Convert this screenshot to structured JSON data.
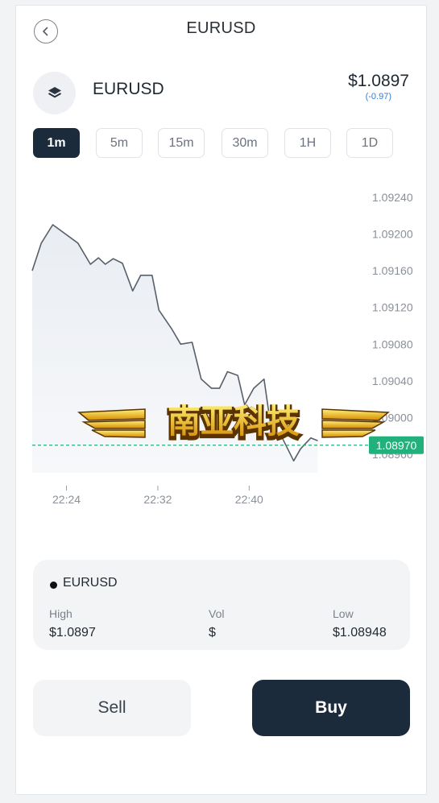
{
  "header": {
    "title": "EURUSD",
    "back_icon": "chevron-left-icon"
  },
  "symbol": {
    "icon": "layers-icon",
    "name": "EURUSD",
    "price": "$1.0897",
    "change": "(-0.97)"
  },
  "timeframes": [
    {
      "label": "1m",
      "active": true
    },
    {
      "label": "5m",
      "active": false
    },
    {
      "label": "15m",
      "active": false
    },
    {
      "label": "30m",
      "active": false
    },
    {
      "label": "1H",
      "active": false
    },
    {
      "label": "1D",
      "active": false
    }
  ],
  "chart_data": {
    "type": "area",
    "y_ticks": [
      "1.09240",
      "1.09200",
      "1.09160",
      "1.09120",
      "1.09080",
      "1.09040",
      "1.09000",
      "1.08960"
    ],
    "ylim": [
      1.0894,
      1.0926
    ],
    "x_ticks": [
      "22:24",
      "22:32",
      "22:40"
    ],
    "x_tick_minutes": [
      24,
      32,
      40
    ],
    "xlim": [
      21.0,
      49.5
    ],
    "series": [
      {
        "x": [
          21.0,
          21.8,
          22.8,
          25.0,
          26.1,
          26.8,
          27.4,
          28.1,
          28.9,
          29.8,
          30.5,
          31.5,
          32.1,
          33.2,
          34.0,
          35.0,
          35.8,
          36.7,
          37.4,
          38.1,
          39.0,
          39.6,
          40.4,
          41.3,
          41.9,
          42.9,
          43.9,
          44.5,
          45.4,
          46.0
        ],
        "values": [
          1.0916,
          1.0919,
          1.0921,
          1.0919,
          1.09167,
          1.09174,
          1.09167,
          1.09173,
          1.09168,
          1.09138,
          1.09155,
          1.09155,
          1.09117,
          1.09097,
          1.0908,
          1.09082,
          1.09042,
          1.09032,
          1.09032,
          1.0905,
          1.09046,
          1.09014,
          1.09032,
          1.09042,
          1.0899,
          1.08978,
          1.08953,
          1.08966,
          1.08978,
          1.08975
        ]
      }
    ],
    "current_price_label": "1.08970",
    "current_price": 1.0897,
    "colors": {
      "line": "#56606b",
      "fill": "#eef1f5",
      "price_line": "#22b07d",
      "price_tag": "#22b07d"
    },
    "grid": false
  },
  "watermark": {
    "text": "南亚科技",
    "colors": {
      "fill_top": "#fff27a",
      "fill_bottom": "#d48a00",
      "outline": "#5a3300"
    }
  },
  "stats": {
    "symbol": "EURUSD",
    "high_label": "High",
    "high_value": "$1.0897",
    "vol_label": "Vol",
    "vol_value": "$",
    "low_label": "Low",
    "low_value": "$1.08948"
  },
  "actions": {
    "sell_label": "Sell",
    "buy_label": "Buy"
  }
}
